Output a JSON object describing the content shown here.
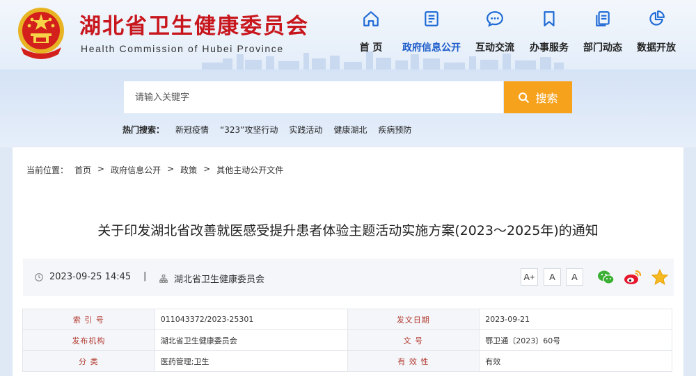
{
  "header": {
    "title": "湖北省卫生健康委员会",
    "subtitle": "Health Commission of Hubei Province",
    "nav": [
      {
        "label": "首  页",
        "icon": "home-icon"
      },
      {
        "label": "政府信息公开",
        "icon": "document-icon"
      },
      {
        "label": "互动交流",
        "icon": "chat-icon"
      },
      {
        "label": "办事服务",
        "icon": "bookmark-icon"
      },
      {
        "label": "部门动态",
        "icon": "pages-icon"
      },
      {
        "label": "数据开放",
        "icon": "pie-chart-icon"
      }
    ],
    "active_nav": "政府信息公开"
  },
  "search": {
    "placeholder": "请输入关键字",
    "button_label": "搜索",
    "hot_label": "热门搜索：",
    "hot_items": [
      "新冠疫情",
      "“323”攻坚行动",
      "实践活动",
      "健康湖北",
      "疾病预防"
    ]
  },
  "breadcrumb": {
    "prefix": "当前位置：",
    "items": [
      "首页",
      "政府信息公开",
      "政策",
      "其他主动公开文件"
    ],
    "separator": ">"
  },
  "article": {
    "title": "关于印发湖北省改善就医感受提升患者体验主题活动实施方案(2023～2025年)的通知",
    "datetime": "2023-09-25 14:45",
    "separator": "|",
    "publisher": "湖北省卫生健康委员会",
    "font_buttons": [
      "A+",
      "A",
      "A"
    ]
  },
  "share": [
    "wechat-icon",
    "weibo-icon",
    "favorite-star-icon"
  ],
  "info": [
    [
      {
        "k": "索  引  号",
        "v": "011043372/2023-25301"
      },
      {
        "k": "发文日期",
        "v": "2023-09-21"
      }
    ],
    [
      {
        "k": "发布机构",
        "v": "湖北省卫生健康委员会"
      },
      {
        "k": "文        号",
        "v": "鄂卫通〔2023〕60号"
      }
    ],
    [
      {
        "k": "分        类",
        "v": "医药管理;卫生"
      },
      {
        "k": "有  效  性",
        "v": "有效"
      }
    ]
  ],
  "colors": {
    "brand_red": "#c8161d",
    "nav_active": "#1c5cc9",
    "search_button": "#f7a21c",
    "icon_blue": "#1f6ad6"
  }
}
